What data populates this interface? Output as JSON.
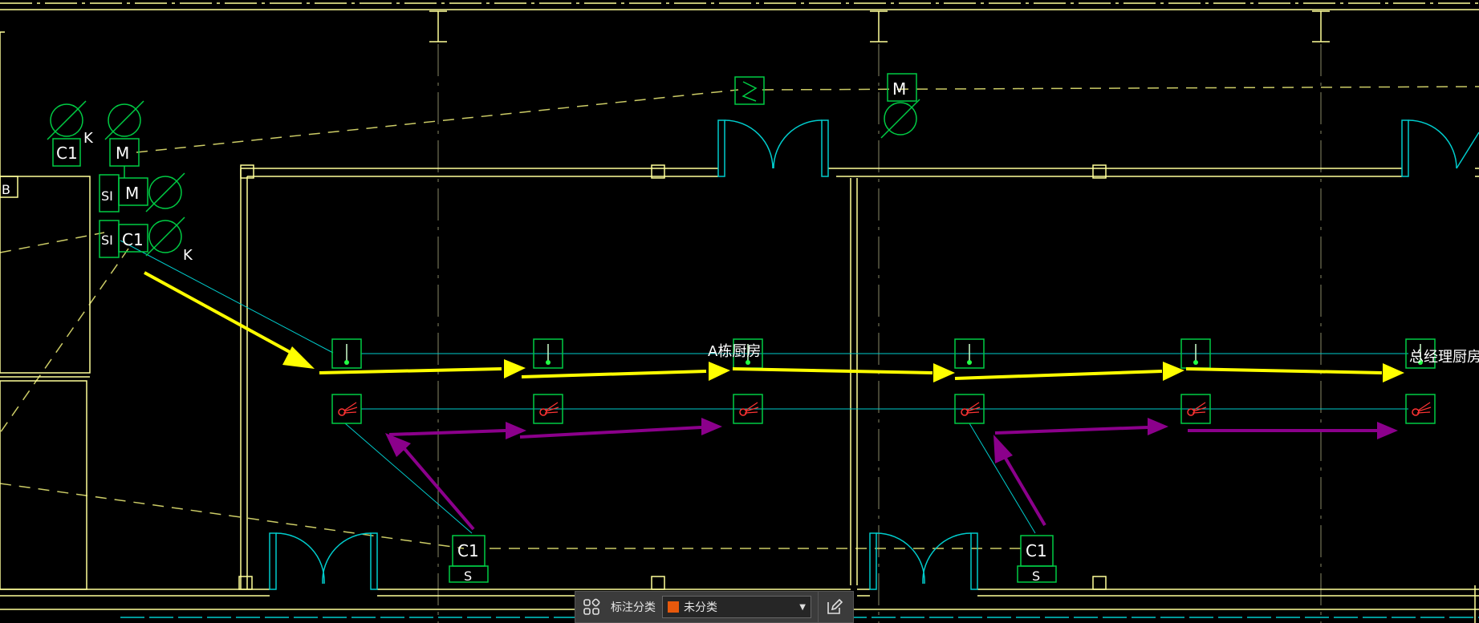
{
  "drawing": {
    "room_labels": [
      "A栋厨房",
      "总经理厨房"
    ],
    "device_codes": {
      "c1": "C1",
      "m": "M",
      "k": "K",
      "si": "SI",
      "s": "S",
      "b": "B"
    }
  },
  "colors": {
    "background": "#000000",
    "wall": "#ffff99",
    "device": "#00cc44",
    "cyan_line": "#00cccc",
    "dashed_yellow": "#cccc66",
    "arrow_yellow": "#ffff00",
    "arrow_purple": "#8b008b",
    "alarm_red": "#ff3333",
    "category_swatch": "#e8590c"
  },
  "toolbar": {
    "grid_icon": "grid-icon",
    "label": "标注分类",
    "category_value": "未分类",
    "edit_icon": "edit-icon"
  }
}
